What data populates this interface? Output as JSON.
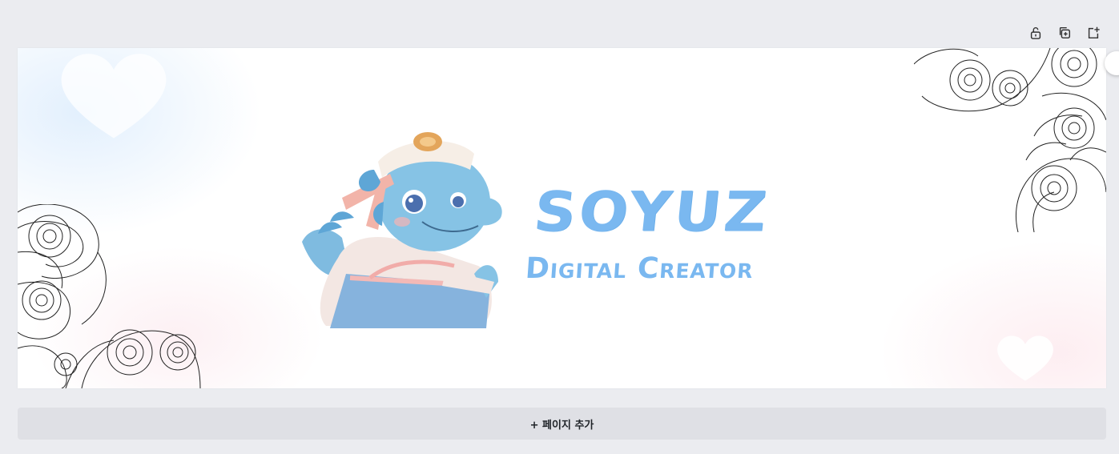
{
  "toolbar": {
    "icons": [
      "lock-open-icon",
      "duplicate-page-icon",
      "add-page-icon"
    ]
  },
  "canvas": {
    "title": "SOYUZ",
    "subtitle": "Digital Creator",
    "accent_color": "#7ab8f0",
    "mascot": "blue-dragon-in-hanbok"
  },
  "footer": {
    "add_page_label": "+ 페이지 추가"
  }
}
